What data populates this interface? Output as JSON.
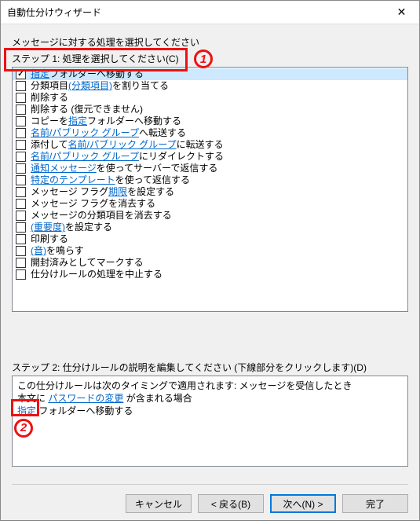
{
  "title": "自動仕分けウィザード",
  "close_glyph": "✕",
  "instruction": "メッセージに対する処理を選択してください",
  "step1_label": "ステップ 1: 処理を選択してください(C)",
  "rules": [
    {
      "checked": true,
      "parts": [
        {
          "link": true,
          "text": "指定"
        },
        {
          "link": false,
          "text": " フォルダーへ移動する"
        }
      ],
      "selected": true
    },
    {
      "checked": false,
      "parts": [
        {
          "link": false,
          "text": "分類項目 "
        },
        {
          "link": true,
          "text": "(分類項目)"
        },
        {
          "link": false,
          "text": " を割り当てる"
        }
      ]
    },
    {
      "checked": false,
      "parts": [
        {
          "link": false,
          "text": "削除する"
        }
      ]
    },
    {
      "checked": false,
      "parts": [
        {
          "link": false,
          "text": "削除する (復元できません)"
        }
      ]
    },
    {
      "checked": false,
      "parts": [
        {
          "link": false,
          "text": "コピーを "
        },
        {
          "link": true,
          "text": "指定"
        },
        {
          "link": false,
          "text": " フォルダーへ移動する"
        }
      ]
    },
    {
      "checked": false,
      "parts": [
        {
          "link": true,
          "text": "名前/パブリック グループ"
        },
        {
          "link": false,
          "text": " へ転送する"
        }
      ]
    },
    {
      "checked": false,
      "parts": [
        {
          "link": false,
          "text": "添付して "
        },
        {
          "link": true,
          "text": "名前/パブリック グループ"
        },
        {
          "link": false,
          "text": " に転送する"
        }
      ]
    },
    {
      "checked": false,
      "parts": [
        {
          "link": true,
          "text": "名前/パブリック グループ"
        },
        {
          "link": false,
          "text": " にリダイレクトする"
        }
      ]
    },
    {
      "checked": false,
      "parts": [
        {
          "link": true,
          "text": "通知メッセージ"
        },
        {
          "link": false,
          "text": " を使ってサーバーで返信する"
        }
      ]
    },
    {
      "checked": false,
      "parts": [
        {
          "link": true,
          "text": "特定のテンプレート"
        },
        {
          "link": false,
          "text": " を使って返信する"
        }
      ]
    },
    {
      "checked": false,
      "parts": [
        {
          "link": false,
          "text": "メッセージ フラグ "
        },
        {
          "link": true,
          "text": "期限"
        },
        {
          "link": false,
          "text": " を設定する"
        }
      ]
    },
    {
      "checked": false,
      "parts": [
        {
          "link": false,
          "text": "メッセージ フラグを消去する"
        }
      ]
    },
    {
      "checked": false,
      "parts": [
        {
          "link": false,
          "text": "メッセージの分類項目を消去する"
        }
      ]
    },
    {
      "checked": false,
      "parts": [
        {
          "link": true,
          "text": "(重要度)"
        },
        {
          "link": false,
          "text": " を設定する"
        }
      ]
    },
    {
      "checked": false,
      "parts": [
        {
          "link": false,
          "text": "印刷する"
        }
      ]
    },
    {
      "checked": false,
      "parts": [
        {
          "link": true,
          "text": "(音)"
        },
        {
          "link": false,
          "text": " を鳴らす"
        }
      ]
    },
    {
      "checked": false,
      "parts": [
        {
          "link": false,
          "text": "開封済みとしてマークする"
        }
      ]
    },
    {
      "checked": false,
      "parts": [
        {
          "link": false,
          "text": "仕分けルールの処理を中止する"
        }
      ]
    }
  ],
  "step2_label": "ステップ 2: 仕分けルールの説明を編集してください (下線部分をクリックします)(D)",
  "desc": {
    "line1": "この仕分けルールは次のタイミングで適用されます: メッセージを受信したとき",
    "line2_pre": "本文に ",
    "line2_link": "パスワードの変更",
    "line2_post": " が含まれる場合",
    "line3_link": "指定",
    "line3_post": " フォルダーへ移動する"
  },
  "buttons": {
    "cancel": "キャンセル",
    "back": "< 戻る(B)",
    "next": "次へ(N) >",
    "finish": "完了"
  },
  "callouts": {
    "one": "1",
    "two": "2"
  }
}
